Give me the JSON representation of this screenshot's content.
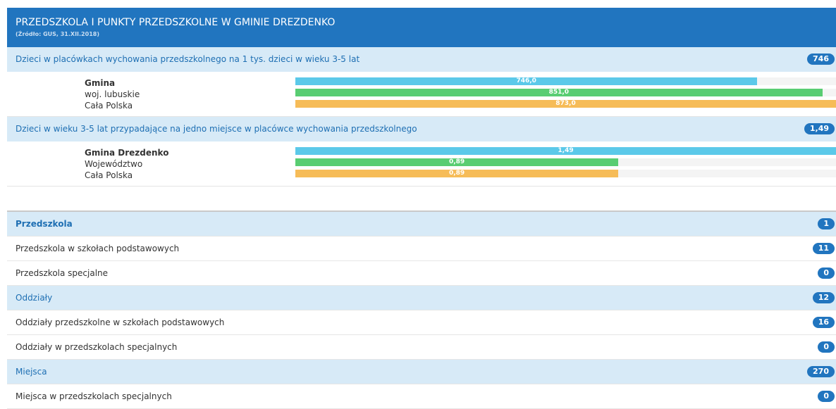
{
  "header": {
    "title": "PRZEDSZKOLA I PUNKTY PRZEDSZKOLNE W GMINIE DREZDENKO",
    "source": "(Źródło: GUS, 31.XII.2018)"
  },
  "indicators": [
    {
      "label": "Dzieci w placówkach wychowania przedszkolnego na 1 tys. dzieci w wieku 3-5 lat",
      "badge": "746",
      "rows": [
        {
          "label": "Gmina",
          "value_label": "746,0"
        },
        {
          "label": "woj. lubuskie",
          "value_label": "851,0"
        },
        {
          "label": "Cała Polska",
          "value_label": "873,0"
        }
      ]
    },
    {
      "label": "Dzieci w wieku 3-5 lat przypadające na jedno miejsce w placówce wychowania przedszkolnego",
      "badge": "1,49",
      "rows": [
        {
          "label": "Gmina Drezdenko",
          "value_label": "1,49"
        },
        {
          "label": "Województwo",
          "value_label": "0,89"
        },
        {
          "label": "Cała Polska",
          "value_label": "0,89"
        }
      ]
    }
  ],
  "list": [
    {
      "label": "Przedszkola",
      "badge": "1"
    },
    {
      "label": "Przedszkola w szkołach podstawowych",
      "badge": "11"
    },
    {
      "label": "Przedszkola specjalne",
      "badge": "0"
    },
    {
      "label": "Oddziały",
      "badge": "12"
    },
    {
      "label": "Oddziały przedszkolne w szkołach podstawowych",
      "badge": "16"
    },
    {
      "label": "Oddziały w przedszkolach specjalnych",
      "badge": "0"
    },
    {
      "label": "Miejsca",
      "badge": "270"
    },
    {
      "label": "Miejsca w przedszkolach specjalnych",
      "badge": "0"
    }
  ],
  "colors": {
    "header": "#2175bf",
    "row_highlight": "#d7eaf7",
    "badge": "#2175bf",
    "bar_local": "#5bc9e9",
    "bar_region": "#59cd72",
    "bar_country": "#f6bc58"
  },
  "chart_data": [
    {
      "type": "bar",
      "orientation": "horizontal",
      "categories": [
        "Gmina",
        "woj. lubuskie",
        "Cała Polska"
      ],
      "values": [
        746.0,
        851.0,
        873.0
      ],
      "xlim": [
        0,
        873.0
      ]
    },
    {
      "type": "bar",
      "orientation": "horizontal",
      "categories": [
        "Gmina Drezdenko",
        "Województwo",
        "Cała Polska"
      ],
      "values": [
        1.49,
        0.89,
        0.89
      ],
      "xlim": [
        0,
        1.49
      ]
    }
  ]
}
